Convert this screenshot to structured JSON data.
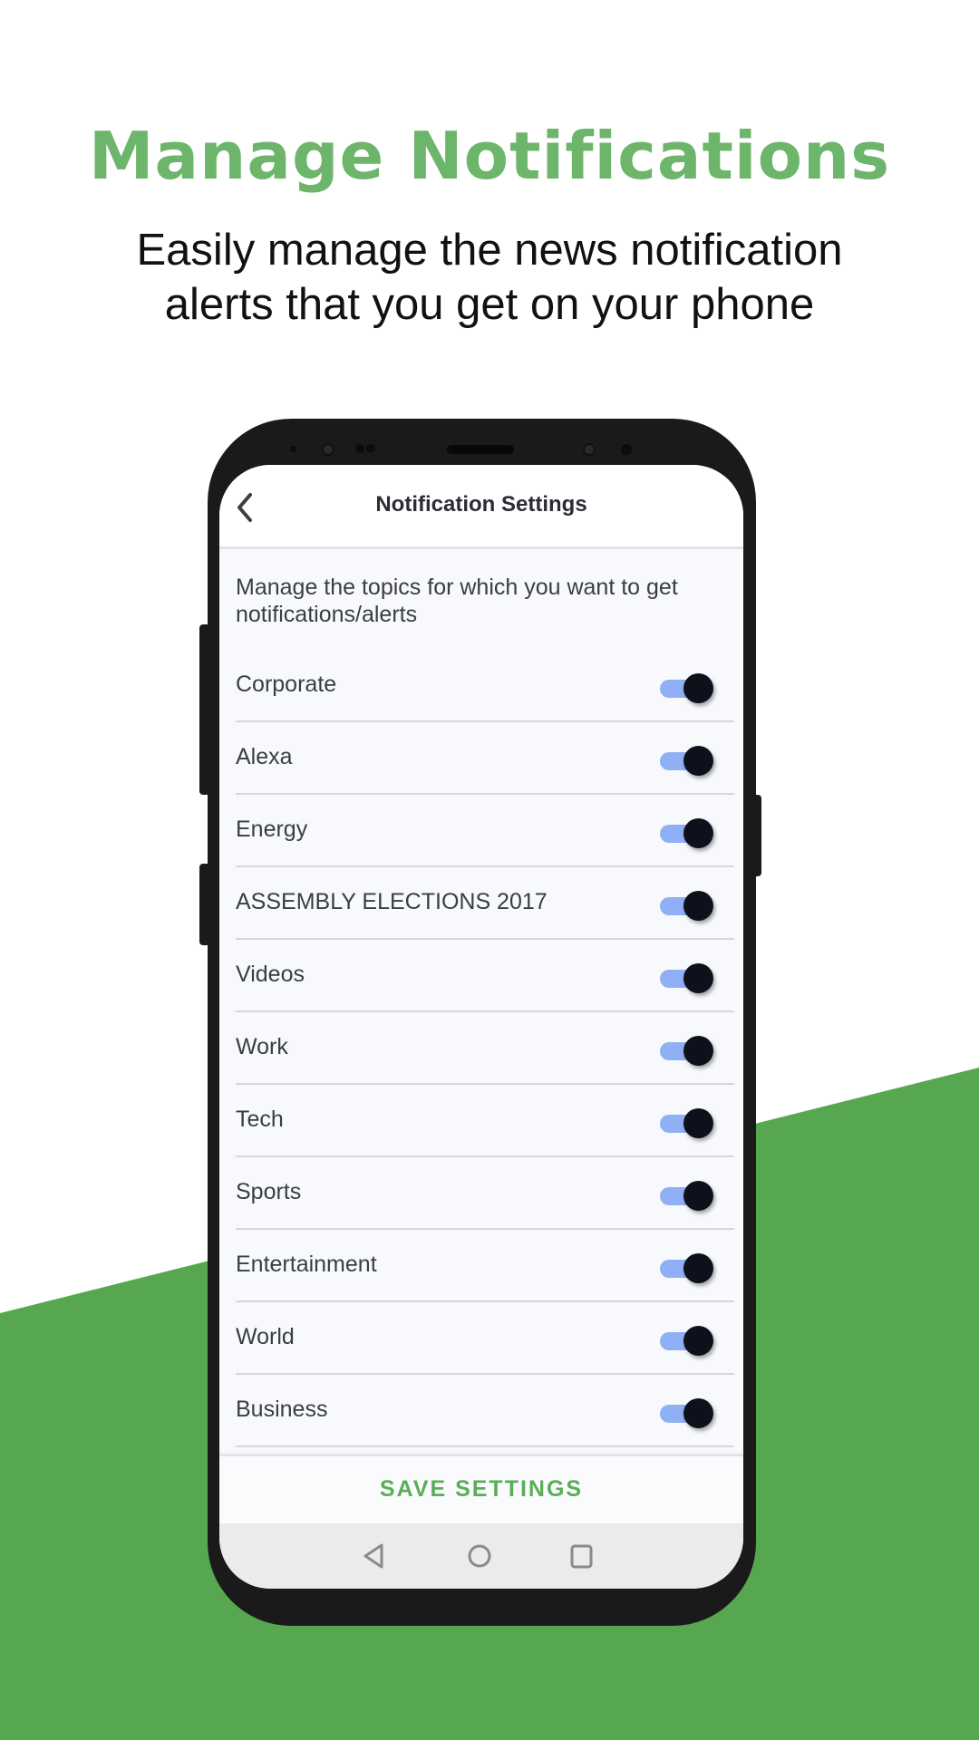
{
  "colors": {
    "accent_green": "#6cb56a",
    "background_green": "#56a74f",
    "toggle_track": "#8fb0f4",
    "toggle_knob": "#0e111c"
  },
  "headline": "Manage Notifications",
  "subtitle_lines": [
    "Easily manage the news notification",
    "alerts that you get on your phone"
  ],
  "app": {
    "header": {
      "title": "Notification Settings",
      "back_icon": "chevron-left-icon"
    },
    "description": "Manage the topics for which you want to get notifications/alerts",
    "topics": [
      {
        "label": "Corporate",
        "enabled": true
      },
      {
        "label": "Alexa",
        "enabled": true
      },
      {
        "label": "Energy",
        "enabled": true
      },
      {
        "label": "ASSEMBLY ELECTIONS 2017",
        "enabled": true
      },
      {
        "label": "Videos",
        "enabled": true
      },
      {
        "label": "Work",
        "enabled": true
      },
      {
        "label": "Tech",
        "enabled": true
      },
      {
        "label": "Sports",
        "enabled": true
      },
      {
        "label": "Entertainment",
        "enabled": true
      },
      {
        "label": "World",
        "enabled": true
      },
      {
        "label": "Business",
        "enabled": true
      }
    ],
    "save_label": "SAVE SETTINGS",
    "nav": [
      "back-triangle-icon",
      "home-circle-icon",
      "recents-square-icon"
    ]
  }
}
